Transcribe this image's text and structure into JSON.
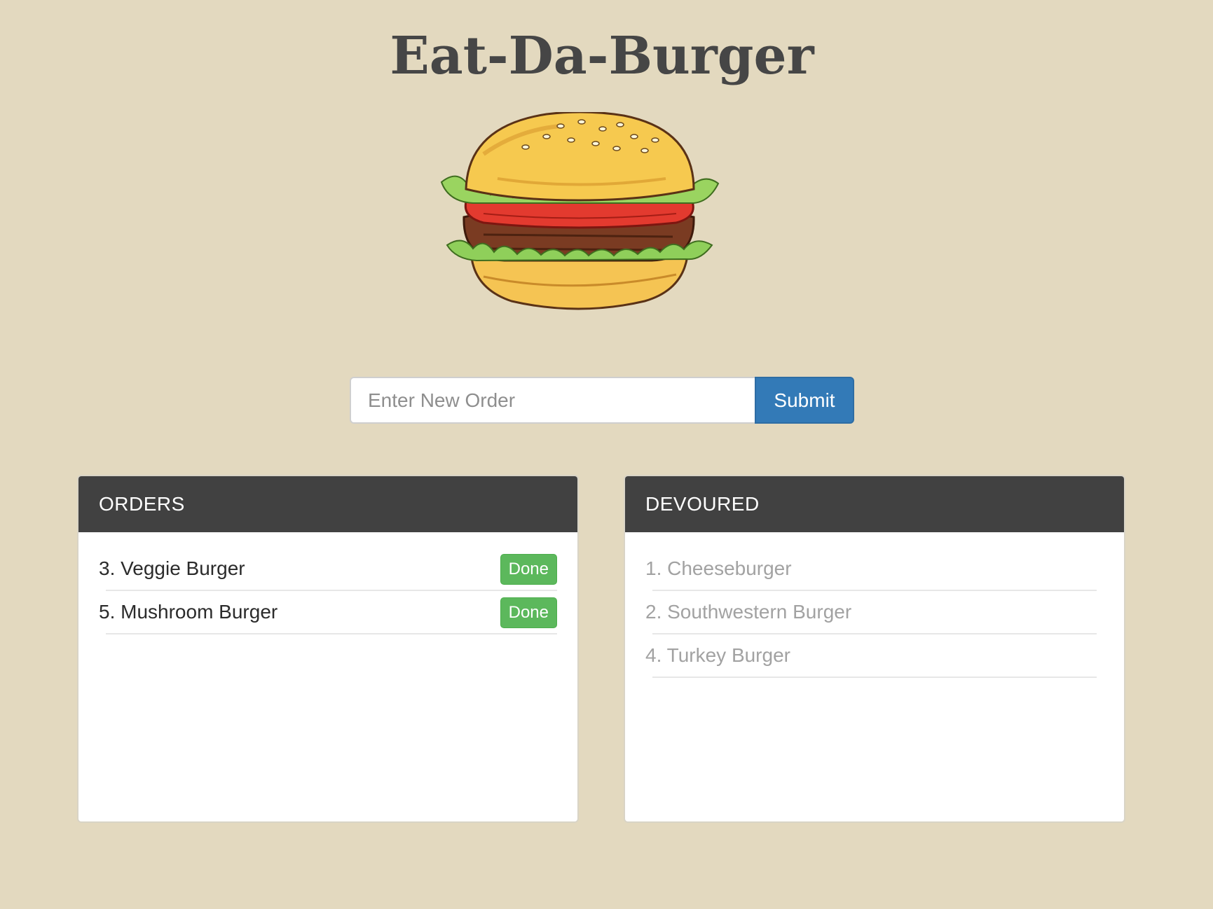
{
  "page": {
    "title": "Eat-Da-Burger"
  },
  "hero": {
    "image_icon": "burger-illustration"
  },
  "order_form": {
    "input_placeholder": "Enter New Order",
    "input_value": "",
    "submit_label": "Submit"
  },
  "orders": {
    "header": "ORDERS",
    "items": [
      {
        "label": "3. Veggie Burger",
        "button": "Done"
      },
      {
        "label": "5. Mushroom Burger",
        "button": "Done"
      }
    ]
  },
  "devoured": {
    "header": "DEVOURED",
    "items": [
      {
        "label": "1. Cheeseburger"
      },
      {
        "label": "2. Southwestern Burger"
      },
      {
        "label": "4. Turkey Burger"
      }
    ]
  },
  "colors": {
    "background": "#e3d9bf",
    "panel_header": "#414141",
    "submit_button": "#337ab7",
    "done_button": "#5cb85c",
    "devoured_text": "#a2a2a2"
  }
}
